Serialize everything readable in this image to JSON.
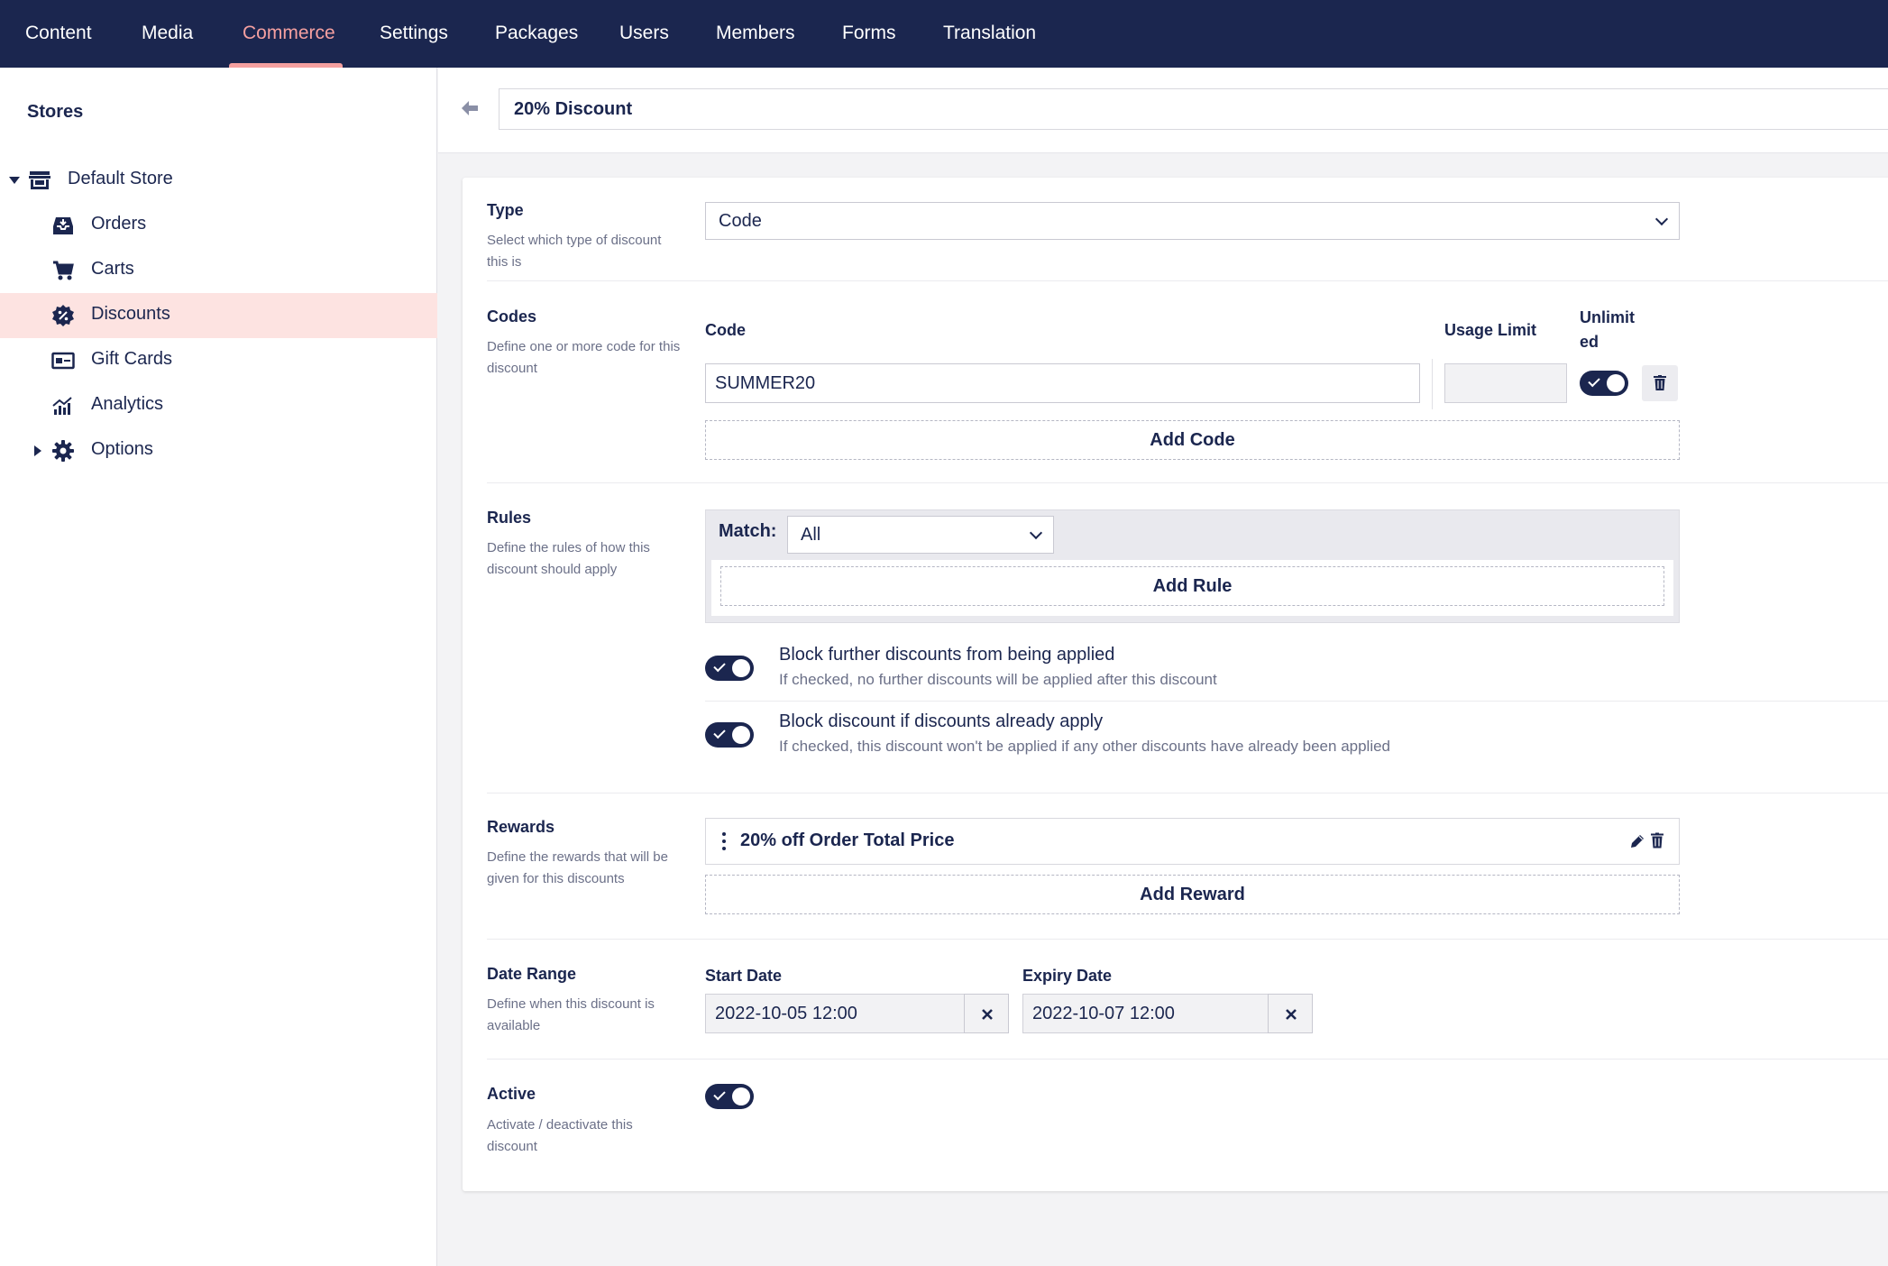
{
  "nav": {
    "items": [
      "Content",
      "Media",
      "Commerce",
      "Settings",
      "Packages",
      "Users",
      "Members",
      "Forms",
      "Translation"
    ],
    "active": "Commerce"
  },
  "sidebar": {
    "title": "Stores",
    "store": "Default Store",
    "items": [
      {
        "label": "Orders",
        "icon": "orders-inbox-icon"
      },
      {
        "label": "Carts",
        "icon": "cart-icon"
      },
      {
        "label": "Discounts",
        "icon": "discount-badge-icon"
      },
      {
        "label": "Gift Cards",
        "icon": "gift-card-icon"
      },
      {
        "label": "Analytics",
        "icon": "analytics-chart-icon"
      },
      {
        "label": "Options",
        "icon": "gear-icon"
      }
    ],
    "selected": "Discounts"
  },
  "header": {
    "name": "20% Discount"
  },
  "type": {
    "label": "Type",
    "description": "Select which type of discount this is",
    "value": "Code"
  },
  "codes": {
    "label": "Codes",
    "description": "Define one or more code for this discount",
    "col_code": "Code",
    "col_usage": "Usage Limit",
    "col_unlimited": "Unlimited",
    "code_value": "SUMMER20",
    "usage_value": "",
    "unlimited_on": true,
    "add_label": "Add Code"
  },
  "rules": {
    "label": "Rules",
    "description": "Define the rules of how this discount should apply",
    "match_label": "Match:",
    "match_value": "All",
    "add_label": "Add Rule",
    "block_further_title": "Block further discounts from being applied",
    "block_further_desc": "If checked, no further discounts will be applied after this discount",
    "block_if_title": "Block discount if discounts already apply",
    "block_if_desc": "If checked, this discount won't be applied if any other discounts have already been applied"
  },
  "rewards": {
    "label": "Rewards",
    "description": "Define the rewards that will be given for this discounts",
    "item": "20% off Order Total Price",
    "add_label": "Add Reward"
  },
  "dates": {
    "label": "Date Range",
    "description": "Define when this discount is available",
    "start_label": "Start Date",
    "start_value": "2022-10-05 12:00",
    "expiry_label": "Expiry Date",
    "expiry_value": "2022-10-07 12:00"
  },
  "active": {
    "label": "Active",
    "description": "Activate / deactivate this discount",
    "on": true
  },
  "colors": {
    "navy": "#1b264f",
    "accent": "#f5a0a0",
    "selected_bg": "#fde3e1"
  }
}
